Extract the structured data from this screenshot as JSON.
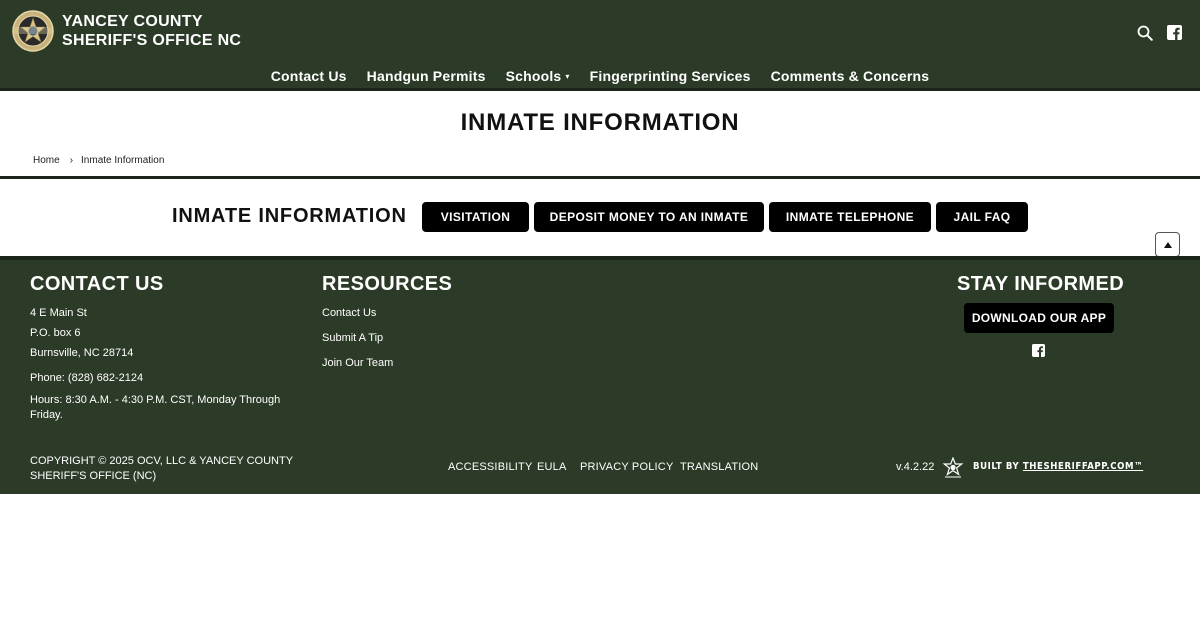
{
  "header": {
    "title_line1": "YANCEY COUNTY",
    "title_line2": "SHERIFF'S OFFICE NC",
    "logo_icon": "sheriff-star-badge",
    "search_icon": "search-icon",
    "facebook_icon": "facebook-icon",
    "background_color": "#2c3b27"
  },
  "nav": {
    "items": [
      {
        "label": "Contact Us"
      },
      {
        "label": "Handgun Permits"
      },
      {
        "label": "Schools",
        "has_dropdown": true,
        "caret": "▾"
      },
      {
        "label": "Fingerprinting Services"
      },
      {
        "label": "Comments & Concerns"
      }
    ]
  },
  "page": {
    "title": "INMATE INFORMATION"
  },
  "breadcrumb": {
    "home": "Home",
    "separator": "›",
    "current": "Inmate Information"
  },
  "inmate_section": {
    "heading": "INMATE INFORMATION",
    "buttons": [
      {
        "label": "VISITATION"
      },
      {
        "label": "DEPOSIT MONEY TO AN INMATE"
      },
      {
        "label": "INMATE TELEPHONE"
      },
      {
        "label": "JAIL FAQ"
      }
    ]
  },
  "footer": {
    "contact": {
      "heading": "CONTACT US",
      "address1": "4 E Main St",
      "address2": "P.O. box 6",
      "address3": "Burnsville, NC 28714",
      "phone": "Phone: (828) 682-2124",
      "hours_line1": "Hours: 8:30 A.M. - 4:30 P.M. CST, Monday Through",
      "hours_line2": "Friday."
    },
    "resources": {
      "heading": "RESOURCES",
      "links": [
        {
          "label": "Contact Us"
        },
        {
          "label": "Submit A Tip"
        },
        {
          "label": "Join Our Team"
        }
      ]
    },
    "stay_informed": {
      "heading": "STAY INFORMED",
      "app_button": "DOWNLOAD OUR APP",
      "facebook_icon": "facebook-icon"
    },
    "copyright_line1": "COPYRIGHT © 2025 OCV, LLC & YANCEY COUNTY",
    "copyright_line2": "SHERIFF'S OFFICE (NC)",
    "legal_links": [
      {
        "label": "ACCESSIBILITY"
      },
      {
        "label": "EULA"
      },
      {
        "label": "PRIVACY POLICY"
      },
      {
        "label": "TRANSLATION"
      }
    ],
    "version": "v.4.2.22",
    "built_by_prefix": "BUILT BY ",
    "built_by_link": "THESHERIFFAPP.COM™",
    "brand_icon": "sheriff-star-icon"
  }
}
